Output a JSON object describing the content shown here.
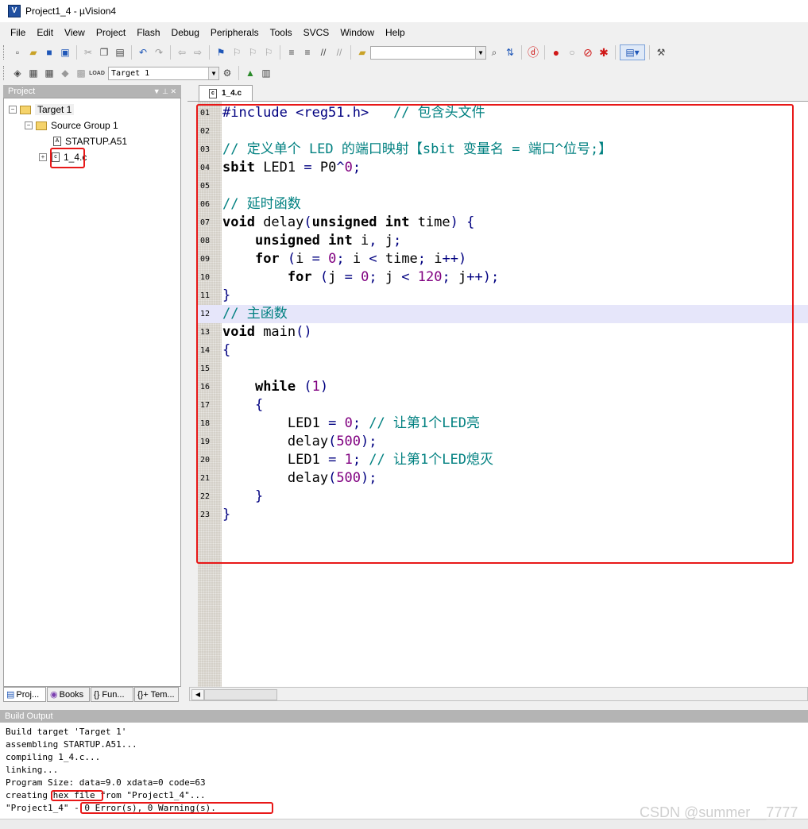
{
  "window": {
    "title": "Project1_4 - µVision4"
  },
  "menu": [
    "File",
    "Edit",
    "View",
    "Project",
    "Flash",
    "Debug",
    "Peripherals",
    "Tools",
    "SVCS",
    "Window",
    "Help"
  ],
  "toolbar": {
    "target_select": "Target 1"
  },
  "project_panel": {
    "header": "Project",
    "header_controls": "▼ ⊥ ✕",
    "tree": {
      "target": "Target 1",
      "group": "Source Group 1",
      "files": [
        "STARTUP.A51",
        "1_4.c"
      ]
    },
    "tabs": [
      "Proj...",
      "Books",
      "{} Fun...",
      "{}+ Tem..."
    ]
  },
  "editor": {
    "tab_label": "1_4.c",
    "lines": [
      {
        "no": "01",
        "segments": [
          {
            "t": "#include <reg51.h>",
            "c": "pp"
          },
          {
            "t": "   // 包含头文件",
            "c": "cm"
          }
        ]
      },
      {
        "no": "02",
        "segments": []
      },
      {
        "no": "03",
        "segments": [
          {
            "t": "// 定义单个 LED 的端口映射【sbit 变量名 = 端口^位号;】",
            "c": "cm"
          }
        ]
      },
      {
        "no": "04",
        "segments": [
          {
            "t": "sbit",
            "c": "kw"
          },
          {
            "t": " LED1 ",
            "c": ""
          },
          {
            "t": "=",
            "c": "op"
          },
          {
            "t": " P0",
            "c": ""
          },
          {
            "t": "^",
            "c": "op"
          },
          {
            "t": "0",
            "c": "nm"
          },
          {
            "t": ";",
            "c": "op"
          }
        ]
      },
      {
        "no": "05",
        "segments": []
      },
      {
        "no": "06",
        "segments": [
          {
            "t": "// 延时函数",
            "c": "cm"
          }
        ]
      },
      {
        "no": "07",
        "segments": [
          {
            "t": "void",
            "c": "kw"
          },
          {
            "t": " delay",
            "c": ""
          },
          {
            "t": "(",
            "c": "op"
          },
          {
            "t": "unsigned int",
            "c": "kw"
          },
          {
            "t": " time",
            "c": ""
          },
          {
            "t": ") {",
            "c": "op"
          }
        ]
      },
      {
        "no": "08",
        "segments": [
          {
            "t": "    ",
            "c": ""
          },
          {
            "t": "unsigned int",
            "c": "kw"
          },
          {
            "t": " i",
            "c": ""
          },
          {
            "t": ",",
            "c": "op"
          },
          {
            "t": " j",
            "c": ""
          },
          {
            "t": ";",
            "c": "op"
          }
        ]
      },
      {
        "no": "09",
        "segments": [
          {
            "t": "    ",
            "c": ""
          },
          {
            "t": "for",
            "c": "kw"
          },
          {
            "t": " (",
            "c": "op"
          },
          {
            "t": "i ",
            "c": ""
          },
          {
            "t": "=",
            "c": "op"
          },
          {
            "t": " ",
            "c": ""
          },
          {
            "t": "0",
            "c": "nm"
          },
          {
            "t": ";",
            "c": "op"
          },
          {
            "t": " i ",
            "c": ""
          },
          {
            "t": "<",
            "c": "op"
          },
          {
            "t": " time",
            "c": ""
          },
          {
            "t": ";",
            "c": "op"
          },
          {
            "t": " i",
            "c": ""
          },
          {
            "t": "++)",
            "c": "op"
          }
        ]
      },
      {
        "no": "10",
        "segments": [
          {
            "t": "        ",
            "c": ""
          },
          {
            "t": "for",
            "c": "kw"
          },
          {
            "t": " (",
            "c": "op"
          },
          {
            "t": "j ",
            "c": ""
          },
          {
            "t": "=",
            "c": "op"
          },
          {
            "t": " ",
            "c": ""
          },
          {
            "t": "0",
            "c": "nm"
          },
          {
            "t": ";",
            "c": "op"
          },
          {
            "t": " j ",
            "c": ""
          },
          {
            "t": "<",
            "c": "op"
          },
          {
            "t": " ",
            "c": ""
          },
          {
            "t": "120",
            "c": "nm"
          },
          {
            "t": ";",
            "c": "op"
          },
          {
            "t": " j",
            "c": ""
          },
          {
            "t": "++);",
            "c": "op"
          }
        ]
      },
      {
        "no": "11",
        "segments": [
          {
            "t": "}",
            "c": "op"
          }
        ]
      },
      {
        "no": "12",
        "segments": [
          {
            "t": "// 主函数",
            "c": "cm"
          }
        ],
        "highlight": true
      },
      {
        "no": "13",
        "segments": [
          {
            "t": "void",
            "c": "kw"
          },
          {
            "t": " main",
            "c": ""
          },
          {
            "t": "()",
            "c": "op"
          }
        ]
      },
      {
        "no": "14",
        "segments": [
          {
            "t": "{",
            "c": "op"
          }
        ]
      },
      {
        "no": "15",
        "segments": []
      },
      {
        "no": "16",
        "segments": [
          {
            "t": "    ",
            "c": ""
          },
          {
            "t": "while",
            "c": "kw"
          },
          {
            "t": " (",
            "c": "op"
          },
          {
            "t": "1",
            "c": "nm"
          },
          {
            "t": ")",
            "c": "op"
          }
        ]
      },
      {
        "no": "17",
        "segments": [
          {
            "t": "    {",
            "c": "op"
          }
        ]
      },
      {
        "no": "18",
        "segments": [
          {
            "t": "        LED1 ",
            "c": ""
          },
          {
            "t": "=",
            "c": "op"
          },
          {
            "t": " ",
            "c": ""
          },
          {
            "t": "0",
            "c": "nm"
          },
          {
            "t": ";",
            "c": "op"
          },
          {
            "t": " // 让第1个LED亮",
            "c": "cm"
          }
        ]
      },
      {
        "no": "19",
        "segments": [
          {
            "t": "        delay",
            "c": ""
          },
          {
            "t": "(",
            "c": "op"
          },
          {
            "t": "500",
            "c": "nm"
          },
          {
            "t": ");",
            "c": "op"
          }
        ]
      },
      {
        "no": "20",
        "segments": [
          {
            "t": "        LED1 ",
            "c": ""
          },
          {
            "t": "=",
            "c": "op"
          },
          {
            "t": " ",
            "c": ""
          },
          {
            "t": "1",
            "c": "nm"
          },
          {
            "t": ";",
            "c": "op"
          },
          {
            "t": " // 让第1个LED熄灭",
            "c": "cm"
          }
        ]
      },
      {
        "no": "21",
        "segments": [
          {
            "t": "        delay",
            "c": ""
          },
          {
            "t": "(",
            "c": "op"
          },
          {
            "t": "500",
            "c": "nm"
          },
          {
            "t": ");",
            "c": "op"
          }
        ]
      },
      {
        "no": "22",
        "segments": [
          {
            "t": "    }",
            "c": "op"
          }
        ]
      },
      {
        "no": "23",
        "segments": [
          {
            "t": "}",
            "c": "op"
          }
        ]
      }
    ]
  },
  "build_output": {
    "header": "Build Output",
    "lines": [
      "Build target 'Target 1'",
      "assembling STARTUP.A51...",
      "compiling 1_4.c...",
      "linking...",
      "Program Size: data=9.0 xdata=0 code=63",
      "creating hex file from \"Project1_4\"...",
      "\"Project1_4\" - 0 Error(s), 0 Warning(s)."
    ]
  },
  "watermark": "CSDN @summer__7777",
  "colors": {
    "annotation_red": "#e81818",
    "comment": "#008080",
    "number": "#800080",
    "operator": "#000080"
  }
}
